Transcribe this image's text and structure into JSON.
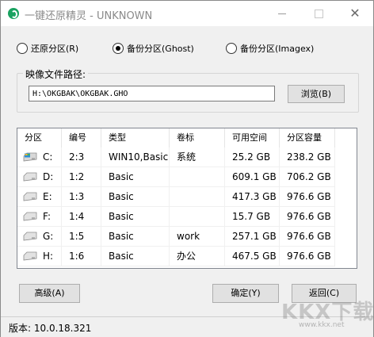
{
  "window": {
    "title": "一键还原精灵 - UNKNOWN",
    "controls": {
      "minimize": "─",
      "maximize": "☐",
      "close": "✕"
    }
  },
  "modes": [
    {
      "label": "还原分区(R)",
      "checked": false
    },
    {
      "label": "备份分区(Ghost)",
      "checked": true
    },
    {
      "label": "备份分区(Imagex)",
      "checked": false
    }
  ],
  "image_path": {
    "group_label": "映像文件路径:",
    "value": "H:\\OKGBAK\\OKGBAK.GHO",
    "browse_label": "浏览(B)"
  },
  "table": {
    "columns": [
      "分区",
      "编号",
      "类型",
      "卷标",
      "可用空间",
      "分区容量"
    ],
    "rows": [
      {
        "drive": "C:",
        "num": "2:3",
        "type": "WIN10,Basic",
        "label": "系统",
        "free": "25.2 GB",
        "capacity": "238.2 GB",
        "icon": "system-drive-icon"
      },
      {
        "drive": "D:",
        "num": "1:2",
        "type": "Basic",
        "label": "",
        "free": "609.1 GB",
        "capacity": "706.2 GB",
        "icon": "drive-icon"
      },
      {
        "drive": "E:",
        "num": "1:3",
        "type": "Basic",
        "label": "",
        "free": "417.3 GB",
        "capacity": "976.6 GB",
        "icon": "drive-icon"
      },
      {
        "drive": "F:",
        "num": "1:4",
        "type": "Basic",
        "label": "",
        "free": "15.7 GB",
        "capacity": "976.6 GB",
        "icon": "drive-icon"
      },
      {
        "drive": "G:",
        "num": "1:5",
        "type": "Basic",
        "label": "work",
        "free": "257.1 GB",
        "capacity": "976.6 GB",
        "icon": "drive-icon"
      },
      {
        "drive": "H:",
        "num": "1:6",
        "type": "Basic",
        "label": "办公",
        "free": "467.5 GB",
        "capacity": "976.6 GB",
        "icon": "drive-icon"
      }
    ]
  },
  "buttons": {
    "advanced": "高级(A)",
    "ok": "确定(Y)",
    "back": "返回(C)"
  },
  "status": {
    "version": "版本: 10.0.18.321"
  },
  "watermark": {
    "text": "KKX下载",
    "url": "www.kkx.net"
  },
  "colors": {
    "app_icon": "#1aa260",
    "window_bg": "#f0f0f0"
  }
}
